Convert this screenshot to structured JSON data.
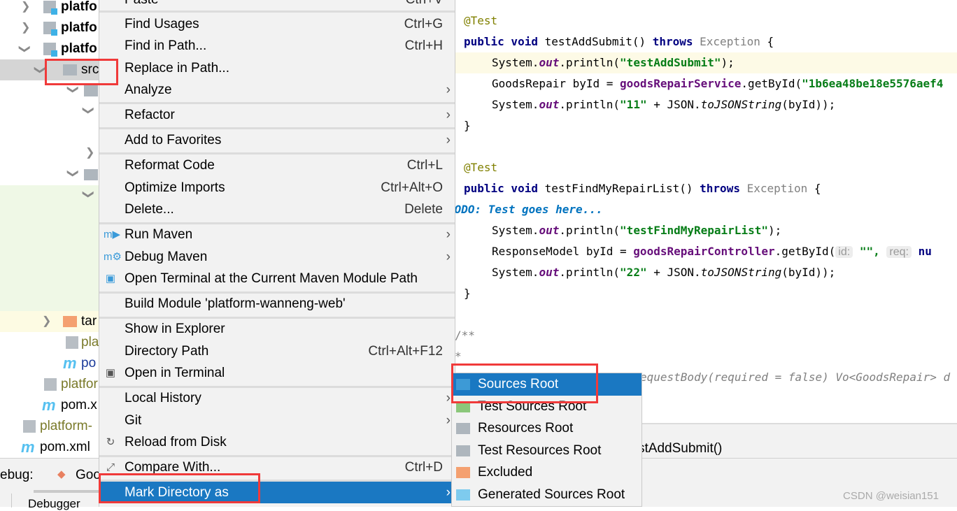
{
  "tree": {
    "items": [
      {
        "label": "platfo",
        "type": "module"
      },
      {
        "label": "platfo",
        "type": "module"
      },
      {
        "label": "platfo",
        "type": "module"
      },
      {
        "label": "src",
        "type": "folder"
      },
      {
        "label": "tar",
        "type": "excluded-folder"
      },
      {
        "label": "pla",
        "type": "iml"
      },
      {
        "label": "po",
        "type": "maven"
      },
      {
        "label": "platfor",
        "type": "iml"
      },
      {
        "label": "pom.x",
        "type": "maven"
      },
      {
        "label": "platform-",
        "type": "iml"
      },
      {
        "label": "pom.xml",
        "type": "maven"
      }
    ]
  },
  "context_menu": {
    "items": [
      {
        "label": "Paste",
        "shortcut": "Ctrl+V"
      },
      {
        "label": "Find Usages",
        "shortcut": "Ctrl+G"
      },
      {
        "label": "Find in Path...",
        "shortcut": "Ctrl+H"
      },
      {
        "label": "Replace in Path..."
      },
      {
        "label": "Analyze",
        "submenu": true
      },
      {
        "label": "Refactor",
        "submenu": true
      },
      {
        "label": "Add to Favorites",
        "submenu": true
      },
      {
        "label": "Reformat Code",
        "shortcut": "Ctrl+L"
      },
      {
        "label": "Optimize Imports",
        "shortcut": "Ctrl+Alt+O"
      },
      {
        "label": "Delete...",
        "shortcut": "Delete"
      },
      {
        "label": "Run Maven",
        "submenu": true,
        "icon": "maven-run-icon"
      },
      {
        "label": "Debug Maven",
        "submenu": true,
        "icon": "maven-debug-icon"
      },
      {
        "label": "Open Terminal at the Current Maven Module Path",
        "icon": "maven-terminal-icon"
      },
      {
        "label": "Build Module 'platform-wanneng-web'"
      },
      {
        "label": "Show in Explorer"
      },
      {
        "label": "Directory Path",
        "shortcut": "Ctrl+Alt+F12"
      },
      {
        "label": "Open in Terminal",
        "icon": "terminal-icon"
      },
      {
        "label": "Local History",
        "submenu": true
      },
      {
        "label": "Git",
        "submenu": true
      },
      {
        "label": "Reload from Disk",
        "icon": "reload-icon"
      },
      {
        "label": "Compare With...",
        "shortcut": "Ctrl+D",
        "icon": "compare-icon"
      },
      {
        "label": "Mark Directory as",
        "submenu": true,
        "selected": true
      }
    ]
  },
  "submenu": {
    "items": [
      {
        "label": "Sources Root",
        "selected": true,
        "color": "#3d9ad6"
      },
      {
        "label": "Test Sources Root",
        "color": "#8bc77a"
      },
      {
        "label": "Resources Root",
        "color": "#aeb6bd"
      },
      {
        "label": "Test Resources Root",
        "color": "#aeb6bd"
      },
      {
        "label": "Excluded",
        "color": "#f4a070"
      },
      {
        "label": "Generated Sources Root",
        "color": "#7ecbee"
      }
    ]
  },
  "editor": {
    "ann1": "@Test",
    "kw_public": "public void ",
    "m1": "testAddSubmit() ",
    "throws": "throws ",
    "exc": "Exception",
    " brace": " {",
    "l3a": "System.",
    "out": "out",
    ".println(": ".println(",
    "s1": "\"testAddSubmit\"",
    "end": ");",
    "l4a": "GoodsRepair byId = ",
    "svc": "goodsRepairService",
    "l4b": ".getById(",
    "s2": "\"1b6ea48be18e5576aef4",
    "s3": "\"11\"",
    "plus": " + JSON.",
    "tojson": "toJSONString",
    "byid": "(byId));",
    "close": "}",
    "m2": "testFindMyRepairList() ",
    "todo": "TODO: Test goes here...",
    "s4": "\"testFindMyRepairList\"",
    "l7a": "ResponseModel byId = ",
    "ctrl": "goodsRepairController",
    "hint_id": "id:",
    "s5": "\"\",",
    "hint_req": "req:",
    "nu": "nu",
    "s6": "\"22\"",
    "doc": "/**",
    "dot": "*",
    "l_req": "equestBody(required = false) Vo<GoodsRepair> d"
  },
  "breadcrumb": "stAddSubmit()",
  "bottom": {
    "debug_label": "ebug:",
    "debug_tab": "Goo",
    "debugger_tab": "Debugger"
  },
  "watermark": "CSDN @weisian151"
}
